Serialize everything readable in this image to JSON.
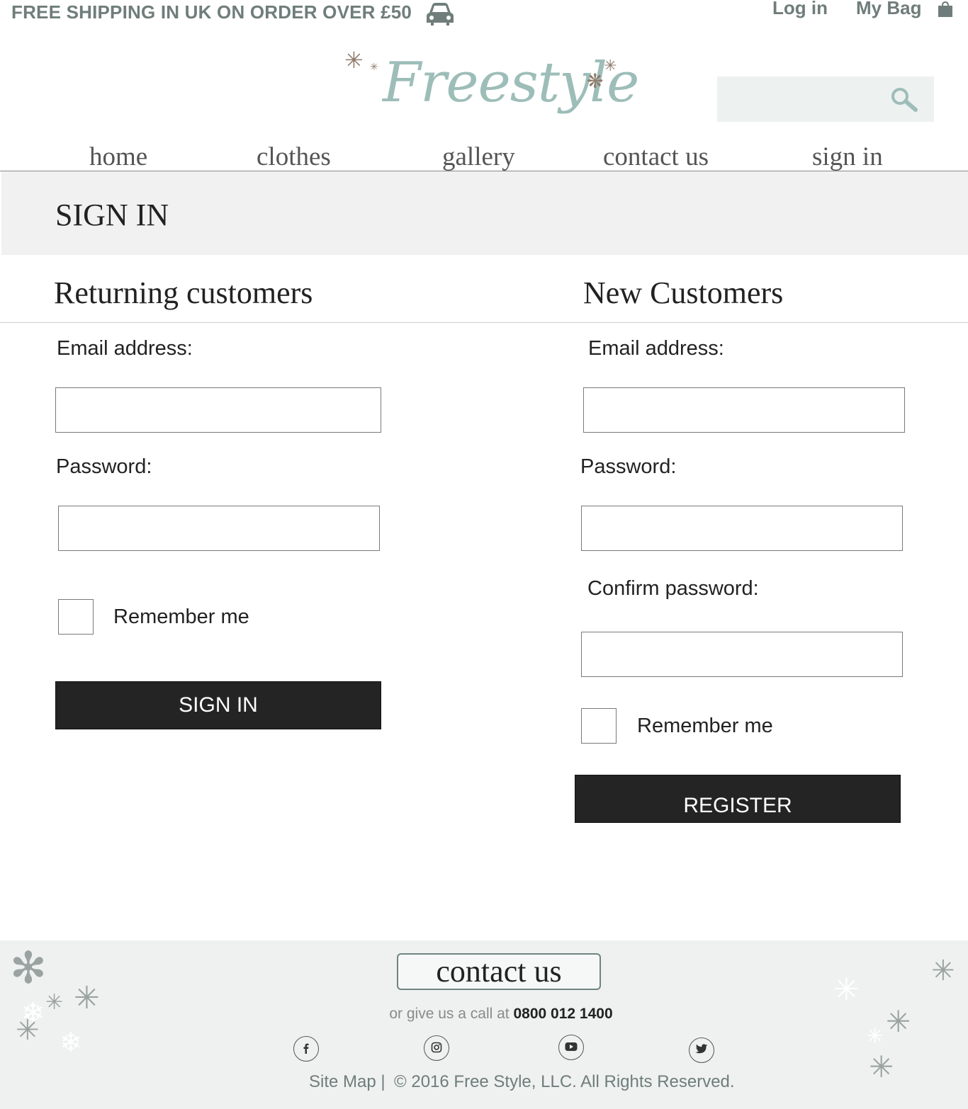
{
  "topbar": {
    "shipping": "FREE SHIPPING IN UK ON ORDER OVER £50",
    "login": "Log in",
    "bag": "My Bag"
  },
  "brand": {
    "logo": "Freestyle"
  },
  "nav": {
    "home": "home",
    "clothes": "clothes",
    "gallery": "gallery",
    "contact": "contact us",
    "signin": "sign in"
  },
  "banner": {
    "title": "SIGN IN"
  },
  "returning": {
    "heading": "Returning customers",
    "email_label": "Email address:",
    "password_label": "Password:",
    "remember_label": "Remember me",
    "submit": "SIGN IN"
  },
  "new_customer": {
    "heading": "New Customers",
    "email_label": "Email address:",
    "password_label": "Password:",
    "confirm_label": "Confirm password:",
    "remember_label": "Remember me",
    "submit": "REGISTER"
  },
  "footer": {
    "contact_button": "contact us",
    "call_text": "or give us a call at",
    "phone": "0800 012 1400",
    "sitemap": "Site Map |",
    "copyright": "© 2016 Free Style, LLC. All Rights Reserved."
  },
  "icons": [
    "car-icon",
    "shopping-bag-icon",
    "search-icon",
    "snowflake-icon",
    "facebook-icon",
    "instagram-icon",
    "youtube-icon",
    "twitter-icon"
  ],
  "colors": {
    "accent": "#9dbdb8",
    "topbar_text": "#6f7d7b",
    "button": "#242424",
    "banner": "#f1f1f1",
    "footer": "#eef1f0"
  }
}
